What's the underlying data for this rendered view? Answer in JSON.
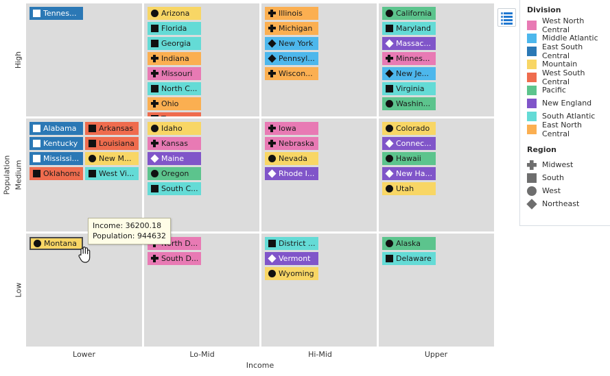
{
  "axes": {
    "y_title": "Population",
    "y_ticks": [
      "High",
      "Medium",
      "Low"
    ],
    "x_title": "Income",
    "x_ticks": [
      "Lower",
      "Lo-Mid",
      "Hi-Mid",
      "Upper"
    ]
  },
  "legend": {
    "division_title": "Division",
    "divisions": [
      {
        "label": "West North Central",
        "color": "#e87ab4"
      },
      {
        "label": "Middle Atlantic",
        "color": "#4db7ec"
      },
      {
        "label": "East South Central",
        "color": "#2b78b5"
      },
      {
        "label": "Mountain",
        "color": "#f8d665"
      },
      {
        "label": "West South Central",
        "color": "#ef6c4e"
      },
      {
        "label": "Pacific",
        "color": "#5cc48d"
      },
      {
        "label": "New England",
        "color": "#8055c9"
      },
      {
        "label": "South Atlantic",
        "color": "#64dbd6"
      },
      {
        "label": "East North Central",
        "color": "#fbaf51"
      }
    ],
    "region_title": "Region",
    "regions": [
      {
        "label": "Midwest",
        "shape": "plus"
      },
      {
        "label": "South",
        "shape": "square"
      },
      {
        "label": "West",
        "shape": "circle"
      },
      {
        "label": "Northeast",
        "shape": "diamond"
      }
    ],
    "toggle_icon": "legend-list-icon"
  },
  "tooltip": {
    "line1": "Income: 36200.18",
    "line2": "Population: 944632"
  },
  "chart_data": {
    "type": "table",
    "title": "",
    "xlabel": "Income",
    "ylabel": "Population",
    "categories_x": [
      "Lower",
      "Lo-Mid",
      "Hi-Mid",
      "Upper"
    ],
    "categories_y": [
      "High",
      "Medium",
      "Low"
    ],
    "panels": [
      {
        "row": "High",
        "col": "Lower",
        "items": [
          {
            "label": "Tennes...",
            "color": "#2b78b5",
            "shape": "square",
            "fg": "#ffffff",
            "glyph": "#ffffff"
          }
        ]
      },
      {
        "row": "High",
        "col": "Lo-Mid",
        "items": [
          {
            "label": "Arizona",
            "color": "#f8d665",
            "shape": "circle",
            "fg": "#1a1a1a",
            "glyph": "#111111"
          },
          {
            "label": "Florida",
            "color": "#64dbd6",
            "shape": "square",
            "fg": "#1a1a1a",
            "glyph": "#111111"
          },
          {
            "label": "Georgia",
            "color": "#64dbd6",
            "shape": "square",
            "fg": "#1a1a1a",
            "glyph": "#111111"
          },
          {
            "label": "Indiana",
            "color": "#fbaf51",
            "shape": "plus",
            "fg": "#1a1a1a",
            "glyph": "#111111"
          },
          {
            "label": "Missouri",
            "color": "#e87ab4",
            "shape": "plus",
            "fg": "#1a1a1a",
            "glyph": "#111111"
          },
          {
            "label": "North C...",
            "color": "#64dbd6",
            "shape": "square",
            "fg": "#1a1a1a",
            "glyph": "#111111"
          },
          {
            "label": "Ohio",
            "color": "#fbaf51",
            "shape": "plus",
            "fg": "#1a1a1a",
            "glyph": "#111111"
          },
          {
            "label": "Texas",
            "color": "#ef6c4e",
            "shape": "square",
            "fg": "#1a1a1a",
            "glyph": "#111111"
          }
        ]
      },
      {
        "row": "High",
        "col": "Hi-Mid",
        "items": [
          {
            "label": "Illinois",
            "color": "#fbaf51",
            "shape": "plus",
            "fg": "#1a1a1a",
            "glyph": "#111111"
          },
          {
            "label": "Michigan",
            "color": "#fbaf51",
            "shape": "plus",
            "fg": "#1a1a1a",
            "glyph": "#111111"
          },
          {
            "label": "New York",
            "color": "#4db7ec",
            "shape": "diamond",
            "fg": "#1a1a1a",
            "glyph": "#111111"
          },
          {
            "label": "Pennsyl...",
            "color": "#4db7ec",
            "shape": "diamond",
            "fg": "#1a1a1a",
            "glyph": "#111111"
          },
          {
            "label": "Wiscon...",
            "color": "#fbaf51",
            "shape": "plus",
            "fg": "#1a1a1a",
            "glyph": "#111111"
          }
        ]
      },
      {
        "row": "High",
        "col": "Upper",
        "items": [
          {
            "label": "California",
            "color": "#5cc48d",
            "shape": "circle",
            "fg": "#1a1a1a",
            "glyph": "#111111"
          },
          {
            "label": "Maryland",
            "color": "#64dbd6",
            "shape": "square",
            "fg": "#1a1a1a",
            "glyph": "#111111"
          },
          {
            "label": "Massac...",
            "color": "#8055c9",
            "shape": "diamond",
            "fg": "#ffffff",
            "glyph": "#ffffff"
          },
          {
            "label": "Minnes...",
            "color": "#e87ab4",
            "shape": "plus",
            "fg": "#1a1a1a",
            "glyph": "#111111"
          },
          {
            "label": "New Je...",
            "color": "#4db7ec",
            "shape": "diamond",
            "fg": "#1a1a1a",
            "glyph": "#111111"
          },
          {
            "label": "Virginia",
            "color": "#64dbd6",
            "shape": "square",
            "fg": "#1a1a1a",
            "glyph": "#111111"
          },
          {
            "label": "Washin...",
            "color": "#5cc48d",
            "shape": "circle",
            "fg": "#1a1a1a",
            "glyph": "#111111"
          }
        ]
      },
      {
        "row": "Medium",
        "col": "Lower",
        "items": [
          {
            "label": "Alabama",
            "color": "#2b78b5",
            "shape": "square",
            "fg": "#ffffff",
            "glyph": "#ffffff"
          },
          {
            "label": "Arkansas",
            "color": "#ef6c4e",
            "shape": "square",
            "fg": "#1a1a1a",
            "glyph": "#111111"
          },
          {
            "label": "Kentucky",
            "color": "#2b78b5",
            "shape": "square",
            "fg": "#ffffff",
            "glyph": "#ffffff"
          },
          {
            "label": "Louisiana",
            "color": "#ef6c4e",
            "shape": "square",
            "fg": "#1a1a1a",
            "glyph": "#111111"
          },
          {
            "label": "Mississi...",
            "color": "#2b78b5",
            "shape": "square",
            "fg": "#ffffff",
            "glyph": "#ffffff"
          },
          {
            "label": "New M...",
            "color": "#f8d665",
            "shape": "circle",
            "fg": "#1a1a1a",
            "glyph": "#111111"
          },
          {
            "label": "Oklahoma",
            "color": "#ef6c4e",
            "shape": "square",
            "fg": "#1a1a1a",
            "glyph": "#111111"
          },
          {
            "label": "West Vi...",
            "color": "#64dbd6",
            "shape": "square",
            "fg": "#1a1a1a",
            "glyph": "#111111"
          }
        ]
      },
      {
        "row": "Medium",
        "col": "Lo-Mid",
        "items": [
          {
            "label": "Idaho",
            "color": "#f8d665",
            "shape": "circle",
            "fg": "#1a1a1a",
            "glyph": "#111111"
          },
          {
            "label": "Kansas",
            "color": "#e87ab4",
            "shape": "plus",
            "fg": "#1a1a1a",
            "glyph": "#111111"
          },
          {
            "label": "Maine",
            "color": "#8055c9",
            "shape": "diamond",
            "fg": "#ffffff",
            "glyph": "#ffffff"
          },
          {
            "label": "Oregon",
            "color": "#5cc48d",
            "shape": "circle",
            "fg": "#1a1a1a",
            "glyph": "#111111"
          },
          {
            "label": "South C...",
            "color": "#64dbd6",
            "shape": "square",
            "fg": "#1a1a1a",
            "glyph": "#111111"
          }
        ]
      },
      {
        "row": "Medium",
        "col": "Hi-Mid",
        "items": [
          {
            "label": "Iowa",
            "color": "#e87ab4",
            "shape": "plus",
            "fg": "#1a1a1a",
            "glyph": "#111111"
          },
          {
            "label": "Nebraska",
            "color": "#e87ab4",
            "shape": "plus",
            "fg": "#1a1a1a",
            "glyph": "#111111"
          },
          {
            "label": "Nevada",
            "color": "#f8d665",
            "shape": "circle",
            "fg": "#1a1a1a",
            "glyph": "#111111"
          },
          {
            "label": "Rhode I...",
            "color": "#8055c9",
            "shape": "diamond",
            "fg": "#ffffff",
            "glyph": "#ffffff"
          }
        ]
      },
      {
        "row": "Medium",
        "col": "Upper",
        "items": [
          {
            "label": "Colorado",
            "color": "#f8d665",
            "shape": "circle",
            "fg": "#1a1a1a",
            "glyph": "#111111"
          },
          {
            "label": "Connec...",
            "color": "#8055c9",
            "shape": "diamond",
            "fg": "#ffffff",
            "glyph": "#ffffff"
          },
          {
            "label": "Hawaii",
            "color": "#5cc48d",
            "shape": "circle",
            "fg": "#1a1a1a",
            "glyph": "#111111"
          },
          {
            "label": "New Ha...",
            "color": "#8055c9",
            "shape": "diamond",
            "fg": "#ffffff",
            "glyph": "#ffffff"
          },
          {
            "label": "Utah",
            "color": "#f8d665",
            "shape": "circle",
            "fg": "#1a1a1a",
            "glyph": "#111111"
          }
        ]
      },
      {
        "row": "Low",
        "col": "Lower",
        "items": [
          {
            "label": "Montana",
            "color": "#f8d665",
            "shape": "circle",
            "fg": "#1a1a1a",
            "glyph": "#111111",
            "selected": true
          }
        ]
      },
      {
        "row": "Low",
        "col": "Lo-Mid",
        "items": [
          {
            "label": "North D...",
            "color": "#e87ab4",
            "shape": "plus",
            "fg": "#1a1a1a",
            "glyph": "#111111"
          },
          {
            "label": "South D...",
            "color": "#e87ab4",
            "shape": "plus",
            "fg": "#1a1a1a",
            "glyph": "#111111"
          }
        ]
      },
      {
        "row": "Low",
        "col": "Hi-Mid",
        "items": [
          {
            "label": "District ...",
            "color": "#64dbd6",
            "shape": "square",
            "fg": "#1a1a1a",
            "glyph": "#111111"
          },
          {
            "label": "Vermont",
            "color": "#8055c9",
            "shape": "diamond",
            "fg": "#ffffff",
            "glyph": "#ffffff"
          },
          {
            "label": "Wyoming",
            "color": "#f8d665",
            "shape": "circle",
            "fg": "#1a1a1a",
            "glyph": "#111111"
          }
        ]
      },
      {
        "row": "Low",
        "col": "Upper",
        "items": [
          {
            "label": "Alaska",
            "color": "#5cc48d",
            "shape": "circle",
            "fg": "#1a1a1a",
            "glyph": "#111111"
          },
          {
            "label": "Delaware",
            "color": "#64dbd6",
            "shape": "square",
            "fg": "#1a1a1a",
            "glyph": "#111111"
          }
        ]
      }
    ]
  }
}
